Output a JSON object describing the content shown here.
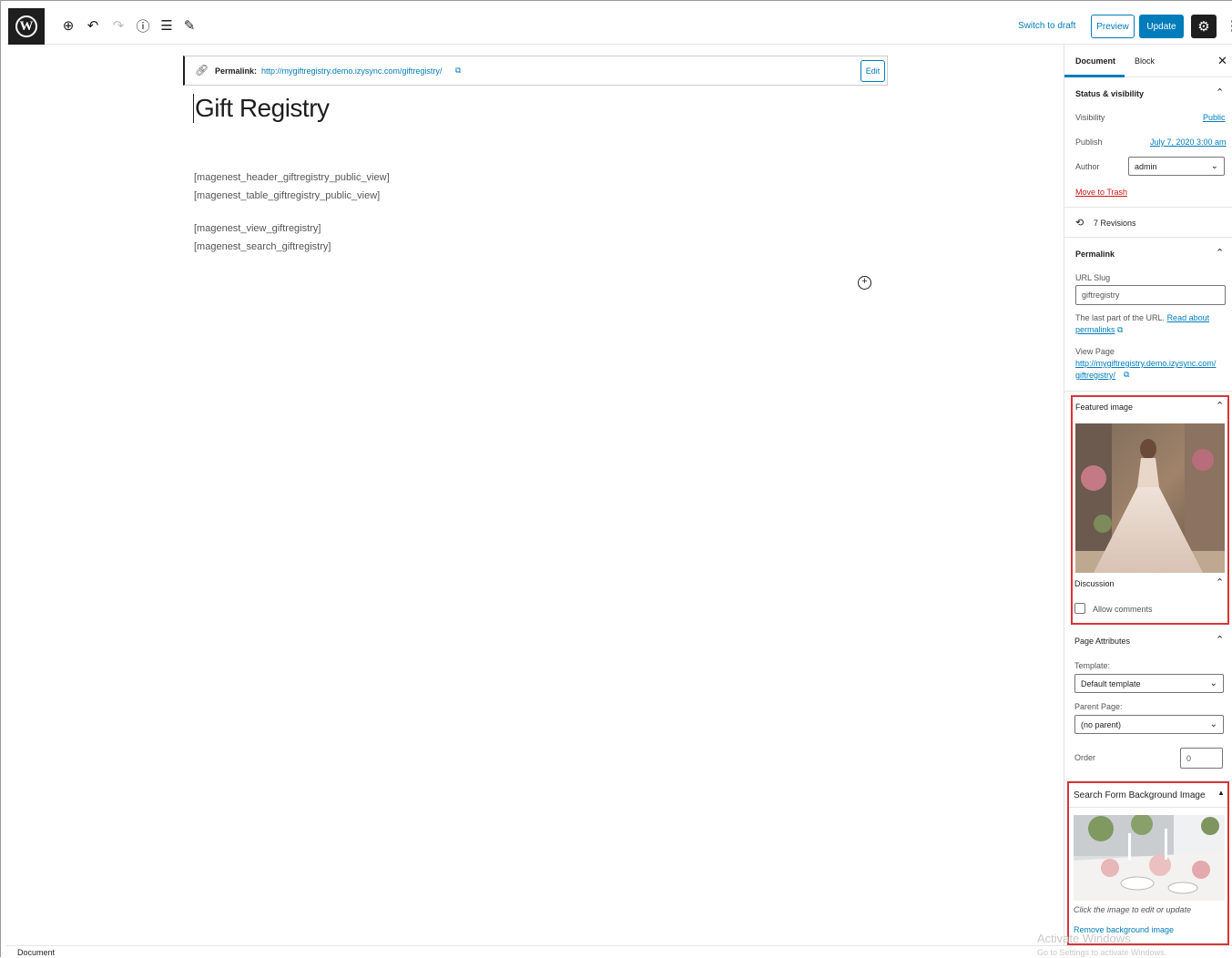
{
  "toolbar": {
    "logo": "W",
    "add_icon": "⊕",
    "undo_icon": "↶",
    "redo_icon": "↷",
    "info_icon": "ⓘ",
    "outline_icon": "☰",
    "tools_icon": "✎",
    "switch_draft": "Switch to draft",
    "preview": "Preview",
    "update": "Update",
    "settings_icon": "⚙",
    "more_icon": "⋮"
  },
  "permalink": {
    "label": "Permalink:",
    "url": "http://mygiftregistry.demo.izysync.com/giftregistry/",
    "external_icon": "⧉",
    "edit": "Edit"
  },
  "post": {
    "title": "Gift Registry",
    "shortcodes": [
      "[magenest_header_giftregistry_public_view]",
      "[magenest_table_giftregistry_public_view]",
      "[magenest_view_giftregistry]",
      "[magenest_search_giftregistry]"
    ]
  },
  "sidebar": {
    "tabs": [
      "Document",
      "Block"
    ],
    "close_icon": "✕",
    "status": {
      "title": "Status & visibility",
      "visibility_label": "Visibility",
      "visibility_value": "Public",
      "publish_label": "Publish",
      "publish_value": "July 7, 2020 3:00 am",
      "author_label": "Author",
      "author_value": "admin",
      "trash": "Move to Trash"
    },
    "revisions": "7 Revisions",
    "permalink_panel": {
      "title": "Permalink",
      "slug_label": "URL Slug",
      "slug_value": "giftregistry",
      "help_text": "The last part of the URL.",
      "help_link": "Read about permalinks",
      "view_label": "View Page",
      "view_link_1": "http://mygiftregistry.demo.izysync.com/",
      "view_link_2": "giftregistry/"
    },
    "featured_image": {
      "title": "Featured image"
    },
    "discussion": {
      "title": "Discussion",
      "allow_comments": "Allow comments",
      "checked": false
    },
    "page_attributes": {
      "title": "Page Attributes",
      "template_label": "Template:",
      "template_value": "Default template",
      "parent_label": "Parent Page:",
      "parent_value": "(no parent)",
      "order_label": "Order",
      "order_value": "0"
    },
    "search_bg": {
      "title": "Search Form Background Image",
      "note": "Click the image to edit or update",
      "remove": "Remove background image"
    }
  },
  "footer": {
    "crumb": "Document"
  },
  "watermark": {
    "line1": "Activate Windows",
    "line2": "Go to Settings to activate Windows."
  },
  "colors": {
    "accent": "#007cba",
    "danger": "#cc1818",
    "highlight_box": "#d63638"
  }
}
